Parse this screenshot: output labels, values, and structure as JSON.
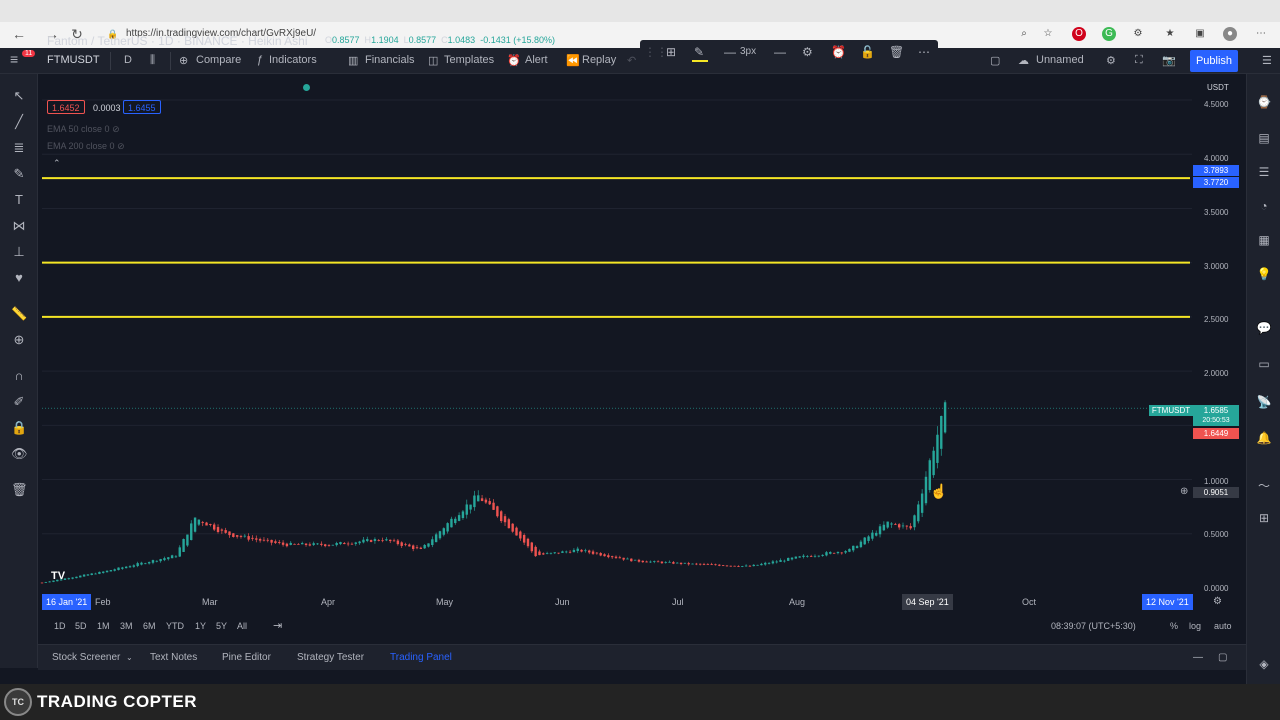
{
  "browser": {
    "url": "https://in.tradingview.com/chart/GvRXj9eU/"
  },
  "topbar": {
    "symbol": "FTMUSDT",
    "interval": "D",
    "compare": "Compare",
    "indicators": "Indicators",
    "financials": "Financials",
    "templates": "Templates",
    "alert": "Alert",
    "replay": "Replay",
    "layout_name": "Unnamed",
    "publish": "Publish",
    "notif_count": "11"
  },
  "legend": {
    "title": "Fantom / TetherUS · 1D · BINANCE · Heikin Ashi",
    "o": "0.8577",
    "h": "1.1904",
    "l": "0.8577",
    "c": "1.0483",
    "change": "-0.1431 (+15.80%)",
    "bid": "1.6452",
    "spread": "0.0003",
    "ask": "1.6455",
    "ema50": "EMA 50 close 0",
    "ema200": "EMA 200 close 0"
  },
  "drawbar": {
    "width_label": "3px"
  },
  "price_axis": {
    "currency": "USDT",
    "labels": [
      "4.5000",
      "4.0000",
      "3.5000",
      "3.0000",
      "2.5000",
      "2.0000",
      "1.0000",
      "0.5000",
      "0.0000"
    ],
    "tag_line_top": "3.7893",
    "tag_line_bottom": "3.7720",
    "tag_symbol": "FTMUSDT",
    "tag_last": "1.6585",
    "tag_countdown": "20:50:53",
    "tag_red": "1.6449",
    "tag_cursor": "0.9051"
  },
  "time_axis": {
    "start_tag": "16 Jan '21",
    "labels": [
      "Feb",
      "Mar",
      "Apr",
      "May",
      "Jun",
      "Jul",
      "Aug",
      "Oct"
    ],
    "cursor_tag": "04 Sep '21",
    "end_tag": "12 Nov '21"
  },
  "range_bar": {
    "ranges": [
      "1D",
      "5D",
      "1M",
      "3M",
      "6M",
      "YTD",
      "1Y",
      "5Y",
      "All"
    ],
    "time": "08:39:07 (UTC+5:30)",
    "percent": "%",
    "log": "log",
    "auto": "auto"
  },
  "bottom_panel": {
    "tabs": [
      "Stock Screener",
      "Text Notes",
      "Pine Editor",
      "Strategy Tester",
      "Trading Panel"
    ]
  },
  "footer": {
    "brand": "TRADING COPTER",
    "logo_text": "TC"
  },
  "chart_data": {
    "type": "candlestick",
    "series": [
      {
        "name": "FTMUSDT"
      }
    ],
    "x_range": [
      "2021-01-16",
      "2021-11-12"
    ],
    "ylim": [
      0,
      4.6
    ],
    "horizontal_lines": [
      3.78,
      3.0,
      2.5
    ],
    "approx_closes": [
      [
        "2021-01-16",
        0.05
      ],
      [
        "2021-02-01",
        0.15
      ],
      [
        "2021-02-20",
        0.3
      ],
      [
        "2021-02-25",
        0.65
      ],
      [
        "2021-03-05",
        0.5
      ],
      [
        "2021-03-20",
        0.4
      ],
      [
        "2021-04-01",
        0.4
      ],
      [
        "2021-04-15",
        0.45
      ],
      [
        "2021-04-25",
        0.35
      ],
      [
        "2021-05-05",
        0.7
      ],
      [
        "2021-05-10",
        0.85
      ],
      [
        "2021-05-20",
        0.5
      ],
      [
        "2021-05-25",
        0.3
      ],
      [
        "2021-06-05",
        0.35
      ],
      [
        "2021-06-20",
        0.25
      ],
      [
        "2021-07-05",
        0.22
      ],
      [
        "2021-07-20",
        0.2
      ],
      [
        "2021-08-01",
        0.28
      ],
      [
        "2021-08-15",
        0.35
      ],
      [
        "2021-08-25",
        0.6
      ],
      [
        "2021-08-31",
        0.55
      ],
      [
        "2021-09-03",
        0.9
      ],
      [
        "2021-09-06",
        1.3
      ],
      [
        "2021-09-09",
        1.65
      ]
    ]
  },
  "colors": {
    "bg": "#131722",
    "up": "#26a69a",
    "down": "#ef5350",
    "hline": "#f5e625",
    "accent": "#2962ff"
  }
}
